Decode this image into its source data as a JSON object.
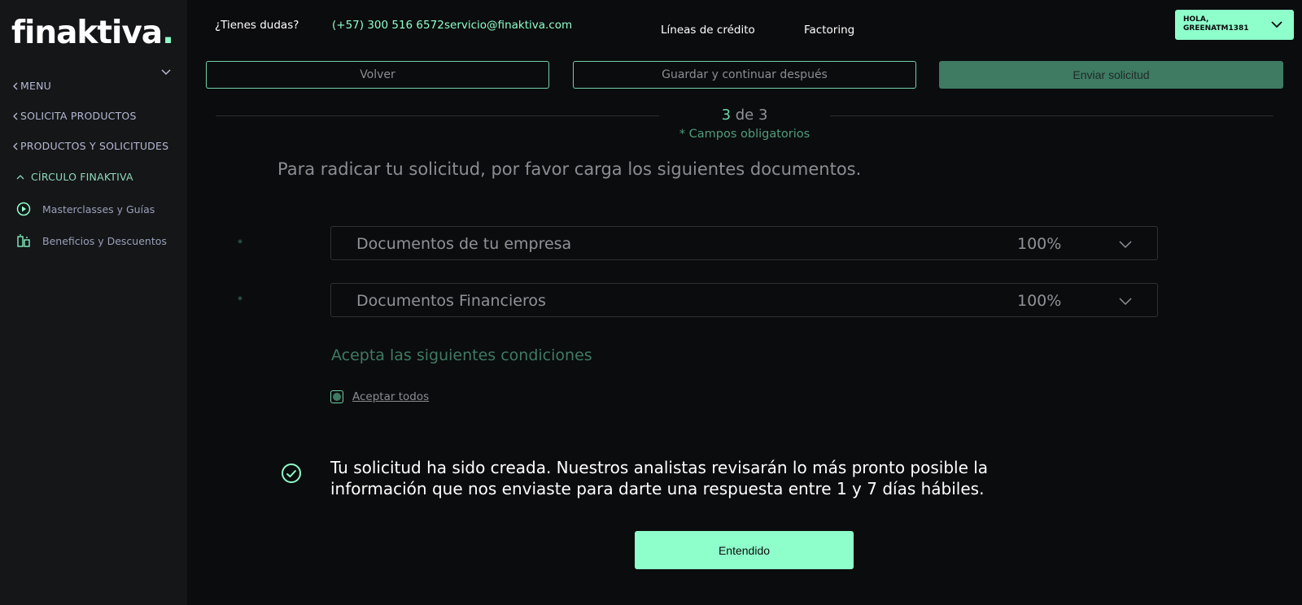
{
  "brand": {
    "logo_text": "finaktiva",
    "logo_dot": ".",
    "accent": "#8effcb"
  },
  "sidebar": {
    "toggle_icon": "chevron-down-icon",
    "items": [
      {
        "label": "MENU",
        "icon": "chevron-left-icon"
      },
      {
        "label": "SOLICITA PRODUCTOS",
        "icon": "chevron-left-icon"
      },
      {
        "label": "PRODUCTOS Y SOLICITUDES",
        "icon": "chevron-left-icon"
      },
      {
        "label": "CÍRCULO FINAKTIVA",
        "icon": "chevron-up-icon"
      }
    ],
    "subitems": [
      {
        "label": "Masterclasses y Guías",
        "icon": "play-circle-icon"
      },
      {
        "label": "Beneficios y Descuentos",
        "icon": "benefits-icon"
      }
    ]
  },
  "topbar": {
    "help_text": "¿Tienes dudas?",
    "phone": "(+57) 300 516 6572",
    "email": "servicio@finaktiva.com",
    "nav": [
      "Líneas de crédito",
      "Factoring"
    ],
    "user_greeting": "HOLA,",
    "user_name": "GREENATM1381"
  },
  "actions": {
    "back": "Volver",
    "save_later": "Guardar y continuar después",
    "submit": "Enviar solicitud"
  },
  "step": {
    "current": "3",
    "separator": " de ",
    "total": "3",
    "required_note": "* Campos obligatorios"
  },
  "headline": "Para radicar tu solicitud, por favor carga los siguientes documentos.",
  "documents": [
    {
      "required_mark": "*",
      "label": "Documentos de tu empresa",
      "progress": "100%"
    },
    {
      "required_mark": "*",
      "label": "Documentos Financieros",
      "progress": "100%"
    }
  ],
  "conditions": {
    "title": "Acepta las siguientes condiciones",
    "accept_all": "Aceptar todos",
    "checked": true
  },
  "success": {
    "icon": "check-circle-icon",
    "line1": "Tu solicitud ha sido creada. Nuestros analistas revisarán lo más pronto posible la",
    "line2": "información que nos enviaste para darte una respuesta entre 1 y 7 días hábiles."
  },
  "confirm_button": "Entendido"
}
